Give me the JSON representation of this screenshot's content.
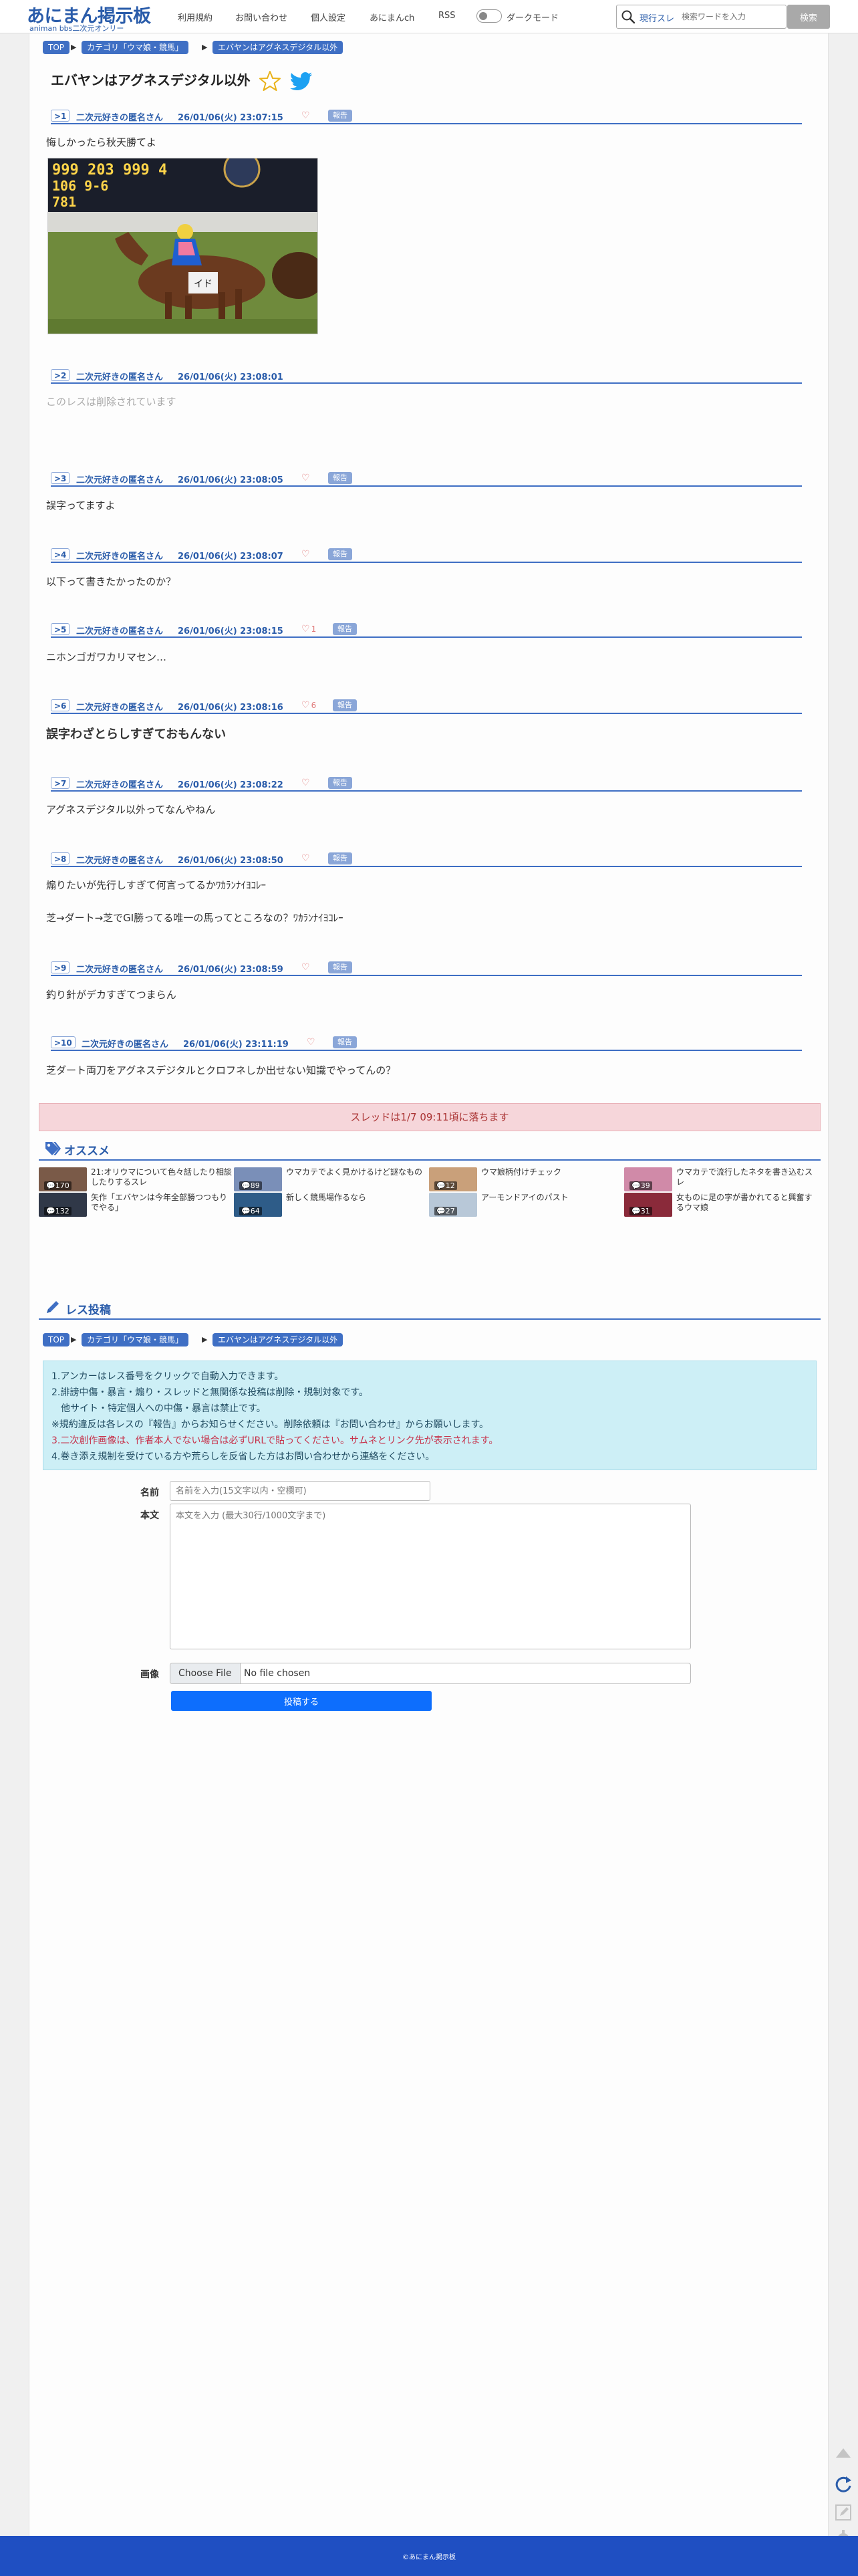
{
  "header": {
    "logo_main": "あにまん掲示板",
    "logo_sub": "animan bbs二次元オンリー",
    "nav": [
      "利用規約",
      "お問い合わせ",
      "個人設定",
      "あにまんch",
      "RSS"
    ],
    "dark_mode_label": "ダークモード",
    "search_scope": "現行スレ",
    "search_placeholder": "検索ワードを入力",
    "search_button": "検索"
  },
  "breadcrumb": [
    "TOP",
    "カテゴリ「ウマ娘・競馬」",
    "エバヤンはアグネスデジタル以外"
  ],
  "thread_title": "エバヤンはアグネスデジタル以外",
  "posts": [
    {
      "num": ">1",
      "name": "二次元好きの匿名さん",
      "date": "26/01/06(火) 23:07:15",
      "likes": "",
      "report": "報告",
      "body": "悔しかったら秋天勝てよ"
    },
    {
      "num": ">2",
      "name": "二次元好きの匿名さん",
      "date": "26/01/06(火) 23:08:01",
      "likes": "",
      "report": "",
      "body": "このレスは削除されています"
    },
    {
      "num": ">3",
      "name": "二次元好きの匿名さん",
      "date": "26/01/06(火) 23:08:05",
      "likes": "",
      "report": "報告",
      "body": "誤字ってますよ"
    },
    {
      "num": ">4",
      "name": "二次元好きの匿名さん",
      "date": "26/01/06(火) 23:08:07",
      "likes": "",
      "report": "報告",
      "body": "以下って書きたかったのか？"
    },
    {
      "num": ">5",
      "name": "二次元好きの匿名さん",
      "date": "26/01/06(火) 23:08:15",
      "likes": "1",
      "report": "報告",
      "body": "ニホンゴガワカリマセン…"
    },
    {
      "num": ">6",
      "name": "二次元好きの匿名さん",
      "date": "26/01/06(火) 23:08:16",
      "likes": "6",
      "report": "報告",
      "body": "誤字わざとらしすぎておもんない"
    },
    {
      "num": ">7",
      "name": "二次元好きの匿名さん",
      "date": "26/01/06(火) 23:08:22",
      "likes": "",
      "report": "報告",
      "body": "アグネスデジタル以外ってなんやねん"
    },
    {
      "num": ">8",
      "name": "二次元好きの匿名さん",
      "date": "26/01/06(火) 23:08:50",
      "likes": "",
      "report": "報告",
      "body": "煽りたいが先行しすぎて何言ってるかﾜｶﾗﾝﾅｲﾖｺﾚｰ",
      "body2": "芝→ダート→芝でGI勝ってる唯一の馬ってところなの？ﾜｶﾗﾝﾅｲﾖｺﾚｰ"
    },
    {
      "num": ">9",
      "name": "二次元好きの匿名さん",
      "date": "26/01/06(火) 23:08:59",
      "likes": "",
      "report": "報告",
      "body": "釣り針がデカすぎてつまらん"
    },
    {
      "num": ">10",
      "name": "二次元好きの匿名さん",
      "date": "26/01/06(火) 23:11:19",
      "likes": "",
      "report": "報告",
      "body": "芝ダート両刀をアグネスデジタルとクロフネしか出せない知識でやってんの？"
    }
  ],
  "fall_notice": "スレッドは1/7 09:11頃に落ちます",
  "recommend": {
    "title": "オススメ",
    "items": [
      {
        "count": "170",
        "text": "21:オリウマについて色々話したり相談したりするスレ",
        "color": "#7a5a48"
      },
      {
        "count": "89",
        "text": "ウマカテでよく見かけるけど謎なもの",
        "color": "#7a8fb8"
      },
      {
        "count": "12",
        "text": "ウマ娘柄付けチェック",
        "color": "#c9a07a"
      },
      {
        "count": "39",
        "text": "ウマカテで流行したネタを書き込むスレ",
        "color": "#d08aa8"
      },
      {
        "count": "132",
        "text": "矢作「エバヤンは今年全部勝つつもりでやる」",
        "color": "#303848"
      },
      {
        "count": "64",
        "text": "新しく競馬場作るなら",
        "color": "#2e5c88"
      },
      {
        "count": "27",
        "text": "アーモンドアイのパスト",
        "color": "#b8c8d8"
      },
      {
        "count": "31",
        "text": "女ものに足の字が書かれてると興奮するウマ娘",
        "color": "#8a2a3a"
      }
    ]
  },
  "reply": {
    "title": "レス投稿",
    "rules": [
      "1.アンカーはレス番号をクリックで自動入力できます。",
      "2.誹謗中傷・暴言・煽り・スレッドと無関係な投稿は削除・規制対象です。",
      "　他サイト・特定個人への中傷・暴言は禁止です。",
      "※規約違反は各レスの『報告』からお知らせください。削除依頼は『お問い合わせ』からお願いします。",
      "3.二次創作画像は、作者本人でない場合は必ずURLで貼ってください。サムネとリンク先が表示されます。",
      "4.巻き添え規制を受けている方や荒らしを反省した方はお問い合わせから連絡をください。"
    ],
    "name_label": "名前",
    "name_placeholder": "名前を入力(15文字以内・空欄可)",
    "body_label": "本文",
    "body_placeholder": "本文を入力 (最大30行/1000文字まで)",
    "image_label": "画像",
    "choose_file": "Choose File",
    "no_file": "No file chosen",
    "submit": "投稿する"
  },
  "footer": {
    "copyright": "©あにまん掲示板"
  },
  "colors": {
    "accent": "#3f6fc4",
    "brand": "#2a5caa",
    "footer": "#1f4fc2",
    "notice_bg": "#f6d6da"
  }
}
